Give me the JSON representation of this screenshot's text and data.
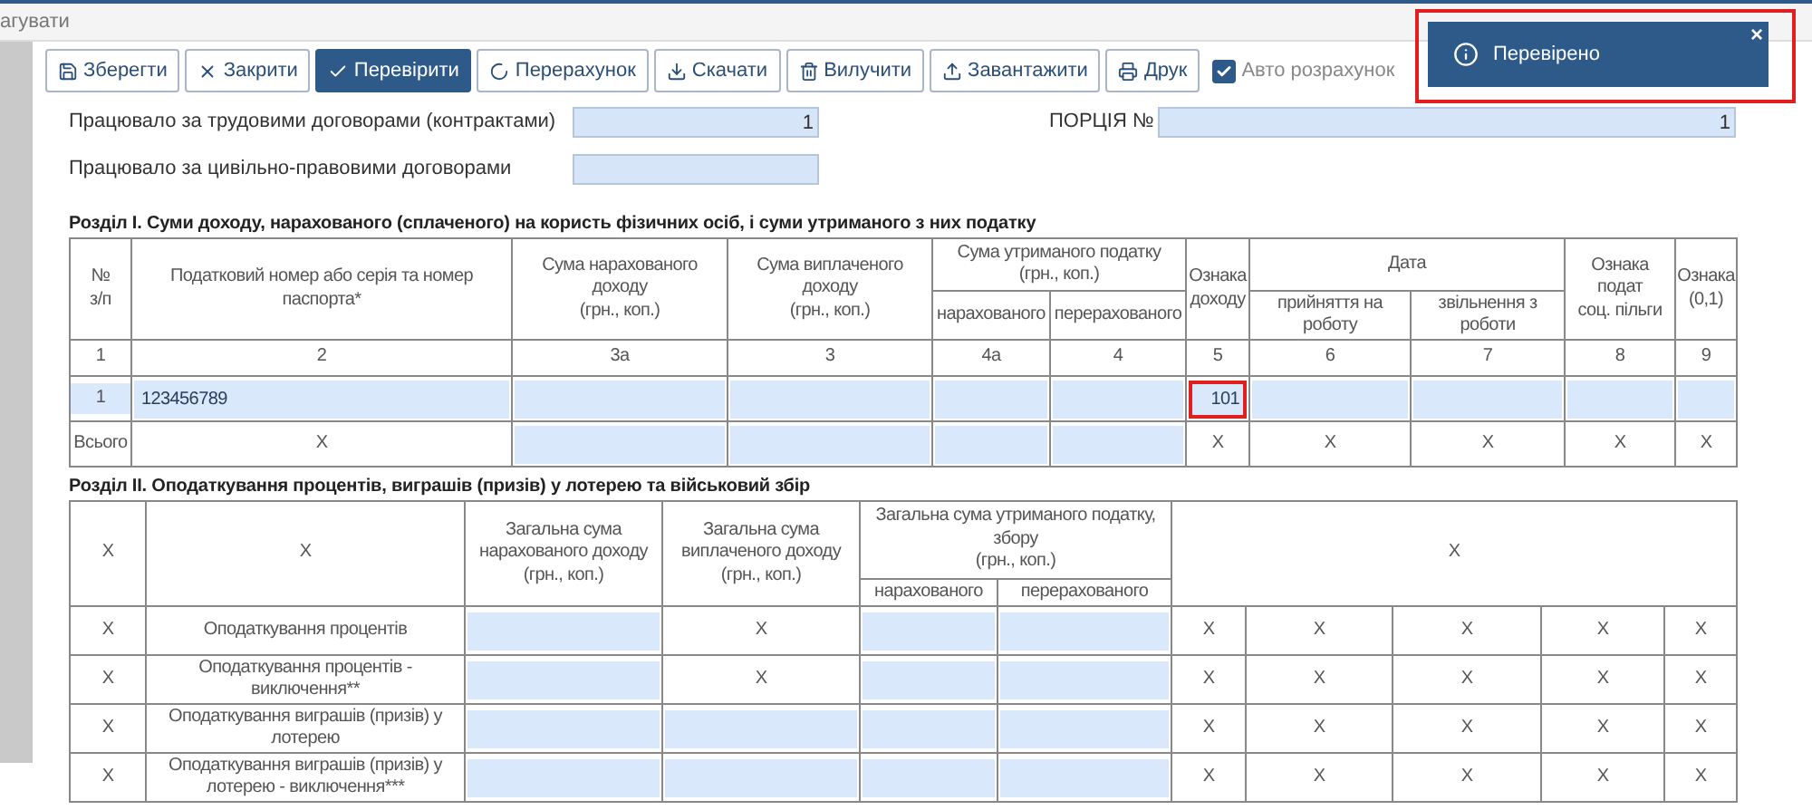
{
  "window": {
    "title": "агувати"
  },
  "toolbar": {
    "buttons": [
      {
        "label": "Зберегти",
        "primary": false
      },
      {
        "label": "Закрити",
        "primary": false
      },
      {
        "label": "Перевірити",
        "primary": true
      },
      {
        "label": "Перерахунок",
        "primary": false
      },
      {
        "label": "Скачати",
        "primary": false
      },
      {
        "label": "Вилучити",
        "primary": false
      },
      {
        "label": "Завантажити",
        "primary": false
      },
      {
        "label": "Друк",
        "primary": false
      }
    ],
    "auto_calc": {
      "label": "Авто розрахунок",
      "checked": true
    }
  },
  "notification": {
    "text": "Перевірено",
    "highlighted": true,
    "close": "×"
  },
  "fields": [
    {
      "label": "Працювало за трудовими договорами (контрактами)",
      "value": "1"
    },
    {
      "label": "Працювало за цивільно-правовими договорами"
    }
  ],
  "portion": {
    "label": "ПОРЦІЯ №",
    "value": "1"
  },
  "section_1": {
    "title": "Розділ I. Суми доходу, нарахованого (сплаченого) на користь фізичних осіб, і суми утриманого з них податку",
    "header": [
      [
        "№\nз/п",
        "Податковий номер або серія та номер\nпаспорта*",
        "Сума нарахованого\nдоходу\n(грн., коп.)",
        "Сума виплаченого\nдоходу\n(грн., коп.)",
        "Сума утриманого податку\n(грн., коп.)",
        "Ознака\nдоходу",
        "Дата",
        "Ознака\nподат\nсоц. пільги",
        "Ознака\n(0,1)"
      ],
      [
        "нарахованого",
        "перерахованого",
        "прийняття на\nроботу",
        "звільнення з\nроботи"
      ]
    ],
    "numbers": [
      "1",
      "2",
      "3а",
      "3",
      "4а",
      "4",
      "5",
      "6",
      "7",
      "8",
      "9"
    ],
    "rows": [
      {
        "kind": "entry",
        "cells": [
          {
            "kind": "text",
            "text": "1"
          },
          {
            "kind": "input",
            "text": "123456789"
          },
          {
            "kind": "input"
          },
          {
            "kind": "input"
          },
          {
            "kind": "input"
          },
          {
            "kind": "input"
          },
          {
            "kind": "input",
            "text": "101",
            "highlighted": true
          },
          {
            "kind": "input"
          },
          {
            "kind": "input"
          },
          {
            "kind": "input"
          },
          {
            "kind": "input"
          }
        ]
      },
      {
        "kind": "total",
        "cells": [
          {
            "kind": "text",
            "text": "Всього"
          },
          {
            "kind": "text",
            "text": "X"
          },
          {
            "kind": "input"
          },
          {
            "kind": "input"
          },
          {
            "kind": "input"
          },
          {
            "kind": "input"
          },
          {
            "kind": "text",
            "text": "X"
          },
          {
            "kind": "text",
            "text": "X"
          },
          {
            "kind": "text",
            "text": "X"
          },
          {
            "kind": "text",
            "text": "X"
          },
          {
            "kind": "text",
            "text": "X"
          }
        ]
      }
    ]
  },
  "section_2": {
    "title": "Розділ II. Оподаткування процентів, виграшів (призів) у лотерею та військовий збір",
    "header": [
      [
        "X",
        "X",
        "Загальна сума\nнарахованого доходу\n(грн., коп.)",
        "Загальна сума\nвиплаченого доходу\n(грн., коп.)",
        "Загальна сума утриманого податку,\nзбору\n(грн., коп.)",
        "X"
      ],
      [
        "нарахованого",
        "перерахованого"
      ]
    ],
    "rows": [
      {
        "cells": [
          {
            "kind": "text",
            "text": "X"
          },
          {
            "kind": "text",
            "text": "Оподаткування процентів"
          },
          {
            "kind": "input"
          },
          {
            "kind": "text",
            "text": "X"
          },
          {
            "kind": "input"
          },
          {
            "kind": "input"
          },
          {
            "kind": "text",
            "text": "X"
          },
          {
            "kind": "text",
            "text": "X"
          },
          {
            "kind": "text",
            "text": "X"
          },
          {
            "kind": "text",
            "text": "X"
          },
          {
            "kind": "text",
            "text": "X"
          }
        ]
      },
      {
        "cells": [
          {
            "kind": "text",
            "text": "X"
          },
          {
            "kind": "text",
            "text": "Оподаткування процентів -\nвиключення**"
          },
          {
            "kind": "input"
          },
          {
            "kind": "text",
            "text": "X"
          },
          {
            "kind": "input"
          },
          {
            "kind": "input"
          },
          {
            "kind": "text",
            "text": "X"
          },
          {
            "kind": "text",
            "text": "X"
          },
          {
            "kind": "text",
            "text": "X"
          },
          {
            "kind": "text",
            "text": "X"
          },
          {
            "kind": "text",
            "text": "X"
          }
        ]
      },
      {
        "cells": [
          {
            "kind": "text",
            "text": "X"
          },
          {
            "kind": "text",
            "text": "Оподаткування виграшів (призів) у\nлотерею"
          },
          {
            "kind": "input"
          },
          {
            "kind": "input"
          },
          {
            "kind": "input"
          },
          {
            "kind": "input"
          },
          {
            "kind": "text",
            "text": "X"
          },
          {
            "kind": "text",
            "text": "X"
          },
          {
            "kind": "text",
            "text": "X"
          },
          {
            "kind": "text",
            "text": "X"
          },
          {
            "kind": "text",
            "text": "X"
          }
        ]
      },
      {
        "cells": [
          {
            "kind": "text",
            "text": "X"
          },
          {
            "kind": "text",
            "text": "Оподаткування виграшів (призів) у\nлотерею - виключення***"
          },
          {
            "kind": "input"
          },
          {
            "kind": "input"
          },
          {
            "kind": "input"
          },
          {
            "kind": "input"
          },
          {
            "kind": "text",
            "text": "X"
          },
          {
            "kind": "text",
            "text": "X"
          },
          {
            "kind": "text",
            "text": "X"
          },
          {
            "kind": "text",
            "text": "X"
          },
          {
            "kind": "text",
            "text": "X"
          }
        ]
      }
    ]
  }
}
